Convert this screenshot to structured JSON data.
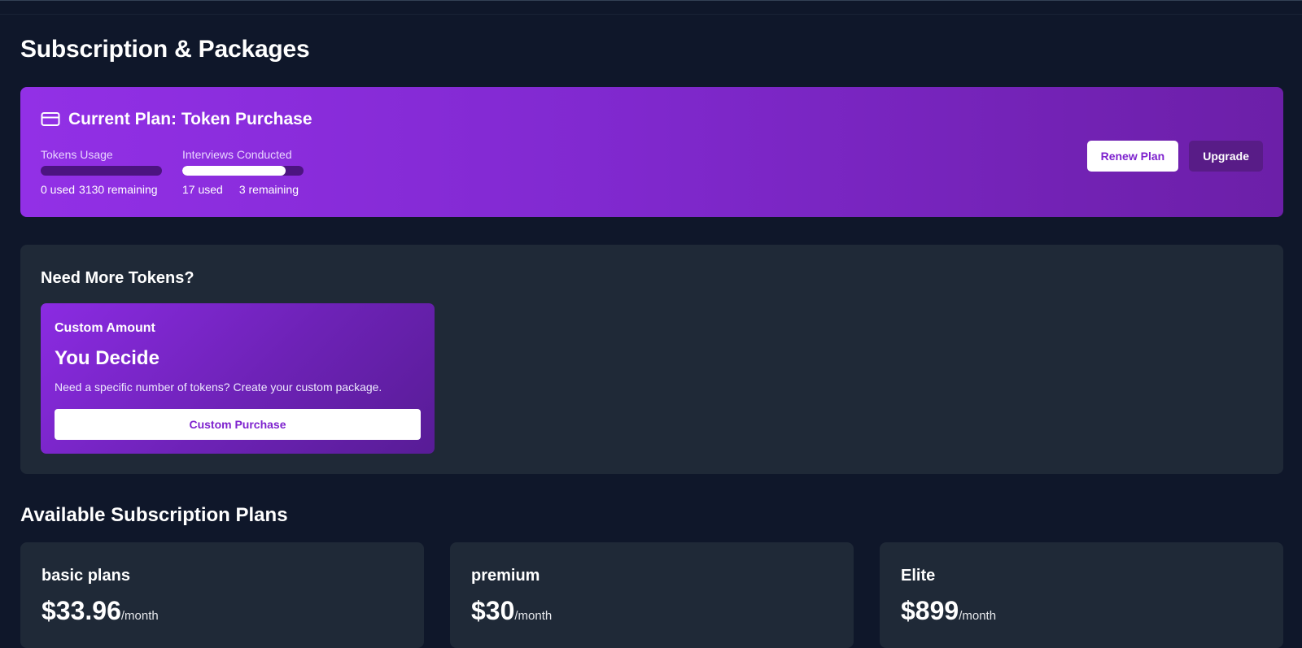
{
  "page": {
    "title": "Subscription & Packages"
  },
  "current_plan": {
    "title": "Current Plan: Token Purchase",
    "icon": "credit-card-icon",
    "tokens": {
      "label": "Tokens Usage",
      "used": "0 used",
      "remaining": "3130 remaining",
      "progress_fraction": 0.0
    },
    "interviews": {
      "label": "Interviews Conducted",
      "used": "17 used",
      "remaining": "3 remaining",
      "progress_fraction": 0.85
    },
    "renew_label": "Renew Plan",
    "upgrade_label": "Upgrade"
  },
  "more_tokens": {
    "heading": "Need More Tokens?",
    "card": {
      "label": "Custom Amount",
      "headline": "You Decide",
      "description": "Need a specific number of tokens? Create your custom package.",
      "button_label": "Custom Purchase"
    }
  },
  "plans": {
    "heading": "Available Subscription Plans",
    "items": [
      {
        "name": "basic plans",
        "price": "$33.96",
        "period": "/month"
      },
      {
        "name": "premium",
        "price": "$30",
        "period": "/month"
      },
      {
        "name": "Elite",
        "price": "$899",
        "period": "/month"
      }
    ]
  },
  "colors": {
    "background": "#0f172a",
    "panel": "#1f2937",
    "accent_purple": "#9230e6",
    "button_text_purple": "#7e22ce",
    "upgrade_bg": "#581c87"
  }
}
